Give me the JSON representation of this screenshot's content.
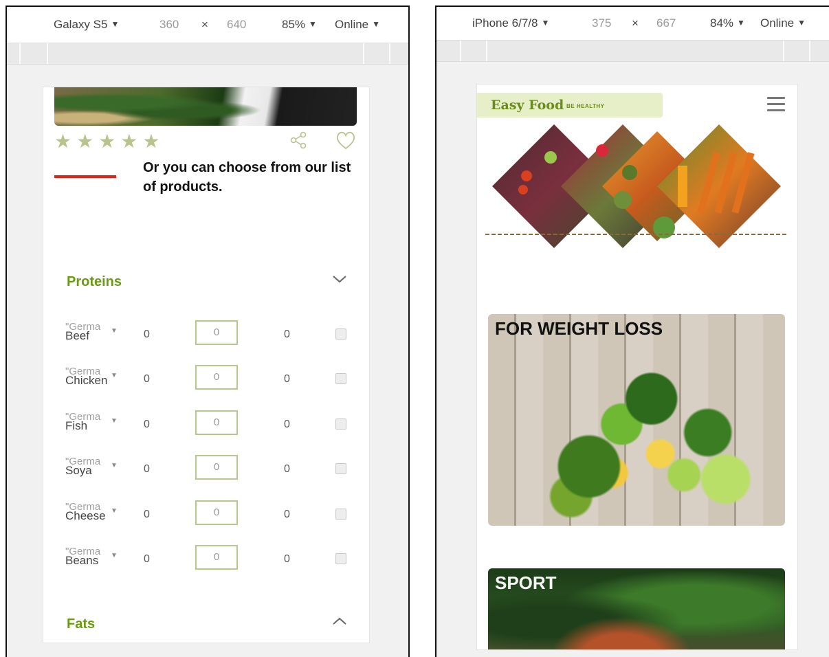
{
  "left": {
    "toolbar": {
      "device": "Galaxy S5",
      "width": "360",
      "times": "×",
      "height": "640",
      "zoom": "85%",
      "network": "Online"
    },
    "rating": {
      "stars": "★★★★★",
      "star_count": 5
    },
    "intro_text": "Or you can choose from our list of products.",
    "sections": {
      "proteins": "Proteins",
      "fats": "Fats"
    },
    "rows": [
      {
        "placeholder": "\"Germa",
        "name": "Beef",
        "value1": "0",
        "qty_placeholder": "0",
        "value2": "0"
      },
      {
        "placeholder": "\"Germa",
        "name": "Chicken",
        "value1": "0",
        "qty_placeholder": "0",
        "value2": "0"
      },
      {
        "placeholder": "\"Germa",
        "name": "Fish",
        "value1": "0",
        "qty_placeholder": "0",
        "value2": "0"
      },
      {
        "placeholder": "\"Germa",
        "name": "Soya",
        "value1": "0",
        "qty_placeholder": "0",
        "value2": "0"
      },
      {
        "placeholder": "\"Germa",
        "name": "Cheese",
        "value1": "0",
        "qty_placeholder": "0",
        "value2": "0"
      },
      {
        "placeholder": "\"Germa",
        "name": "Beans",
        "value1": "0",
        "qty_placeholder": "0",
        "value2": "0"
      }
    ]
  },
  "right": {
    "toolbar": {
      "device": "iPhone 6/7/8",
      "width": "375",
      "times": "×",
      "height": "667",
      "zoom": "84%",
      "network": "Online"
    },
    "brand": {
      "name": "Easy Food",
      "tagline": "BE HEALTHY"
    },
    "cards": {
      "weight_loss": "FOR WEIGHT LOSS",
      "sport": "SPORT"
    }
  },
  "colors": {
    "accent_green": "#6a9a12",
    "red_line": "#e2231a",
    "star": "#b8c48d",
    "brand_bg": "#e7efc8"
  },
  "icons": [
    "share-icon",
    "heart-icon",
    "chevron-down-icon",
    "chevron-up-icon",
    "hamburger-menu-icon",
    "dropdown-arrow-icon"
  ]
}
